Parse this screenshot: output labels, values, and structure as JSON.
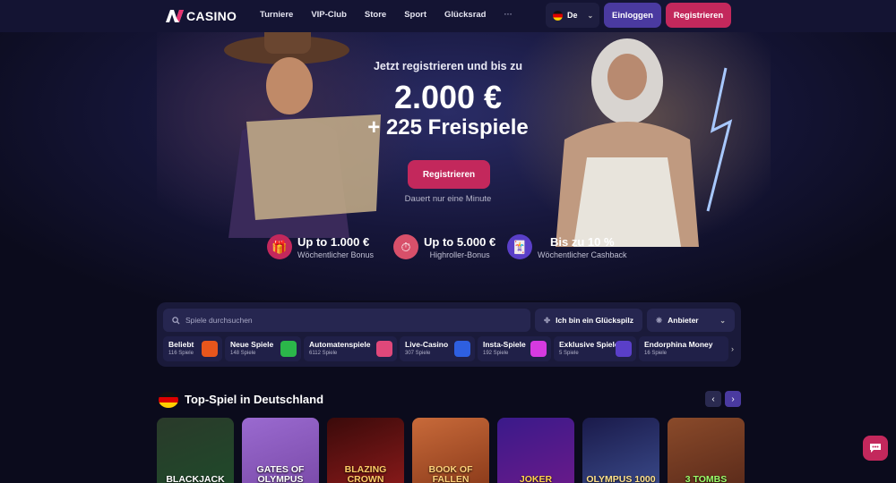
{
  "header": {
    "logo_text": "CASINO",
    "nav": [
      "Turniere",
      "VIP-Club",
      "Store",
      "Sport",
      "Glücksrad",
      "···"
    ],
    "language": "De",
    "login_label": "Einloggen",
    "register_label": "Registrieren"
  },
  "hero": {
    "subtitle": "Jetzt registrieren und bis zu",
    "amount": "2.000 €",
    "spins": "+ 225 Freispiele",
    "cta_label": "Registrieren",
    "note": "Dauert nur eine Minute"
  },
  "bonuses": [
    {
      "title": "Up to 1.000 €",
      "subtitle": "Wöchentlicher Bonus",
      "icon": "gift-calendar-icon"
    },
    {
      "title": "Up to 5.000 €",
      "subtitle": "Highroller-Bonus",
      "icon": "clock-coin-icon"
    },
    {
      "title": "Bis zu 10 %",
      "subtitle": "Wöchentlicher Cashback",
      "icon": "cards-coin-icon"
    }
  ],
  "games_panel": {
    "search_placeholder": "Spiele durchsuchen",
    "lucky_label": "Ich bin ein Glückspilz",
    "provider_label": "Anbieter",
    "categories": [
      {
        "name": "Beliebt",
        "count": "116 Spiele",
        "color": "#e8561c"
      },
      {
        "name": "Neue Spiele",
        "count": "148 Spiele",
        "color": "#2bb74a"
      },
      {
        "name": "Automatenspiele",
        "count": "6112 Spiele",
        "color": "#e0487a"
      },
      {
        "name": "Live-Casino",
        "count": "307 Spiele",
        "color": "#2e5fe0"
      },
      {
        "name": "Insta-Spiele",
        "count": "192 Spiele",
        "color": "#d63ae0"
      },
      {
        "name": "Exklusive Spiele",
        "count": "5 Spiele",
        "color": "#5a3fc8"
      },
      {
        "name": "Endorphina Money",
        "count": "16 Spiele",
        "color": "#3a3a6a"
      }
    ]
  },
  "top_games": {
    "title": "Top-Spiel in Deutschland",
    "games": [
      {
        "title": "BLACKJACK",
        "color": "#1f4a2a"
      },
      {
        "title": "GATES OF OLYMPUS",
        "color": "#7a4aa8"
      },
      {
        "title": "BLAZING CROWN",
        "color": "#8a1a1a"
      },
      {
        "title": "BOOK OF FALLEN",
        "color": "#8a3a1a"
      },
      {
        "title": "JOKER",
        "color": "#6a1a8a"
      },
      {
        "title": "OLYMPUS 1000",
        "color": "#3a4a8a"
      },
      {
        "title": "3 TOMBS",
        "color": "#5a2a1a"
      }
    ]
  },
  "colors": {
    "accent": "#c3285c",
    "login": "#4a3aa0",
    "background": "#0b0b1c"
  }
}
